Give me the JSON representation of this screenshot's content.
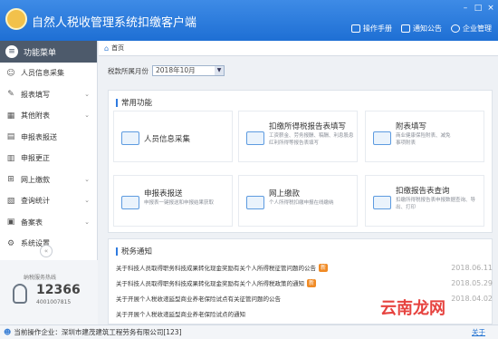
{
  "app": {
    "title": "自然人税收管理系统扣缴客户端",
    "header_links": [
      {
        "label": "操作手册",
        "icon": "book-icon"
      },
      {
        "label": "通知公告",
        "icon": "mail-icon"
      },
      {
        "label": "企业管理",
        "icon": "person-icon"
      }
    ],
    "window_controls": [
      "minimize-icon",
      "maximize-icon",
      "close-icon"
    ]
  },
  "sidebar": {
    "header": "功能菜单",
    "items": [
      {
        "label": "人员信息采集",
        "icon": "user-icon",
        "expandable": false
      },
      {
        "label": "报表填写",
        "icon": "edit-icon",
        "expandable": true
      },
      {
        "label": "其他附表",
        "icon": "grid-icon",
        "expandable": true
      },
      {
        "label": "申报表报送",
        "icon": "document-icon",
        "expandable": false
      },
      {
        "label": "申报更正",
        "icon": "document-edit-icon",
        "expandable": false
      },
      {
        "label": "网上缴款",
        "icon": "cart-icon",
        "expandable": true
      },
      {
        "label": "查询统计",
        "icon": "chart-icon",
        "expandable": true
      },
      {
        "label": "备案表",
        "icon": "folder-icon",
        "expandable": true
      },
      {
        "label": "系统设置",
        "icon": "gear-icon",
        "expandable": false
      }
    ],
    "hotline": {
      "label": "纳税服务热线",
      "number": "12366",
      "sub_number": "4001007815"
    }
  },
  "main": {
    "tab": "首页",
    "period": {
      "label": "税款所属月份",
      "value": "2018年10月"
    },
    "common_functions": {
      "title": "常用功能",
      "cards": [
        {
          "title": "人员信息采集",
          "desc": "",
          "icon": "id-card-icon"
        },
        {
          "title": "扣缴所得税报告表填写",
          "desc": "工资薪金、劳务报酬、稿酬、利息股息红利所得等报告表填写",
          "icon": "form-icon"
        },
        {
          "title": "附表填写",
          "desc": "商业健康保险附表、减免事项附表",
          "icon": "pencil-icon"
        },
        {
          "title": "申报表报送",
          "desc": "申报表一键报送和申报结果获取",
          "icon": "upload-icon"
        },
        {
          "title": "网上缴款",
          "desc": "个人所得税扣缴申报在线缴纳",
          "icon": "bank-card-icon"
        },
        {
          "title": "扣缴报告表查询",
          "desc": "扣缴所得税报告表申报数据查询、导出、打印",
          "icon": "search-icon"
        }
      ]
    },
    "notices": {
      "title": "税务通知",
      "items": [
        {
          "text": "关于科技人员取得职务科技成果转化现金奖励有关个人所得税征管问题的公告",
          "date": "2018.06.11",
          "is_new": true
        },
        {
          "text": "关于科技人员取得职务科技成果转化现金奖励有关个人所得税政策的通知",
          "date": "2018.05.29",
          "is_new": true
        },
        {
          "text": "关于开展个人税收递延型商业养老保险试点有关征管问题的公告",
          "date": "2018.04.02",
          "is_new": false
        },
        {
          "text": "关于开展个人税收递延型商业养老保险试点的通知",
          "date": "",
          "is_new": false
        }
      ],
      "new_label": "新"
    }
  },
  "status": {
    "text": "当前操作企业：深圳市建茂建筑工程劳务有限公司[123]",
    "link": "关于"
  },
  "watermark": "云南龙网"
}
